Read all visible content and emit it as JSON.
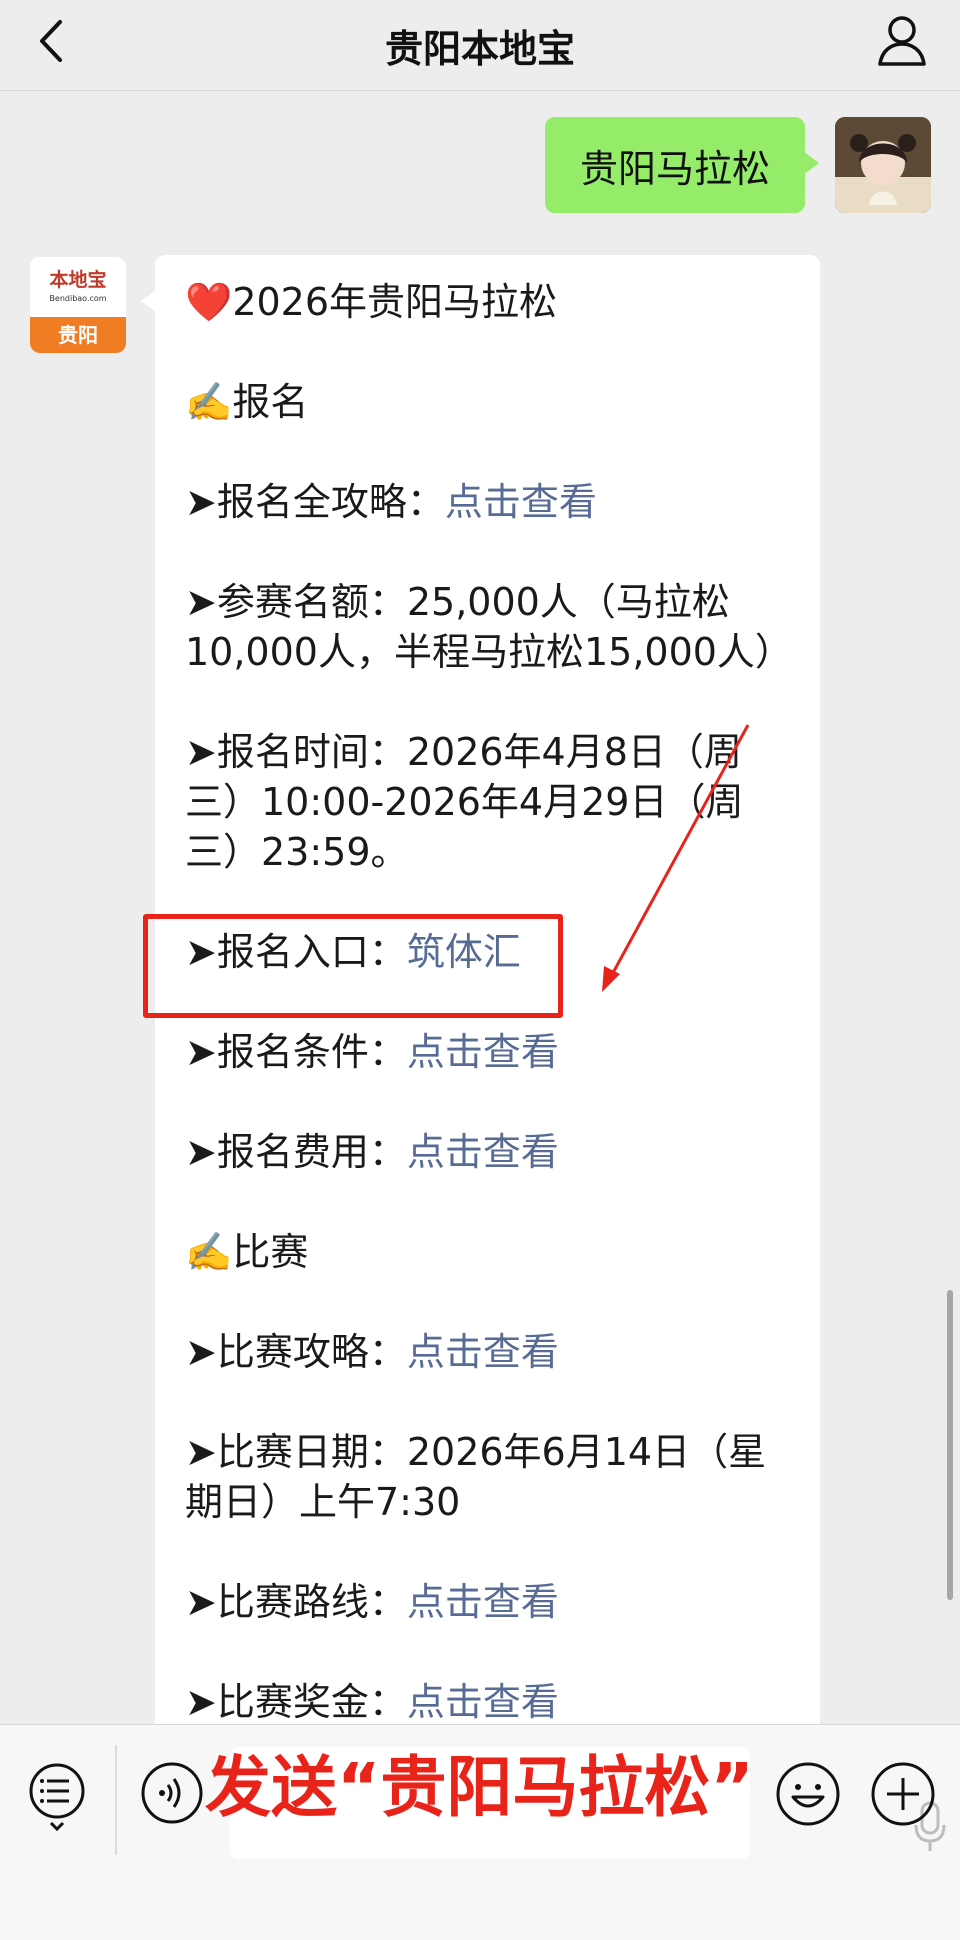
{
  "header": {
    "title": "贵阳本地宝"
  },
  "sent_message": {
    "text": "贵阳马拉松"
  },
  "account_avatar": {
    "logo_text": "本地宝",
    "url_text": "Bendibao.com",
    "city": "贵阳"
  },
  "message": {
    "title": "❤️2026年贵阳马拉松",
    "section_signup": "✍️报名",
    "signup_guide": {
      "label": "➤报名全攻略：",
      "link": "点击查看"
    },
    "quota": {
      "label": "➤参赛名额：25,000人（马拉松10,000人，半程马拉松15,000人）"
    },
    "signup_time": {
      "label": "➤报名时间：2026年4月8日（周三）10:00-2026年4月29日（周三）23:59。"
    },
    "signup_entry": {
      "label": "➤报名入口：",
      "link": "筑体汇"
    },
    "signup_conditions": {
      "label": "➤报名条件：",
      "link": "点击查看"
    },
    "signup_fees": {
      "label": "➤报名费用：",
      "link": "点击查看"
    },
    "section_race": "✍️比赛",
    "race_guide": {
      "label": "➤比赛攻略：",
      "link": "点击查看"
    },
    "race_date": {
      "label": "➤比赛日期：2026年6月14日（星期日）上午7:30"
    },
    "race_route": {
      "label": "➤比赛路线：",
      "link": "点击查看"
    },
    "race_prize": {
      "label": "➤比赛奖金：",
      "link": "点击查看"
    }
  },
  "annotation": {
    "overlay_text": "发送“贵阳马拉松”"
  },
  "colors": {
    "link": "#576b95",
    "sent_bubble": "#95ec69",
    "annotation_red": "#e8231a",
    "brand_orange": "#f07c24"
  }
}
